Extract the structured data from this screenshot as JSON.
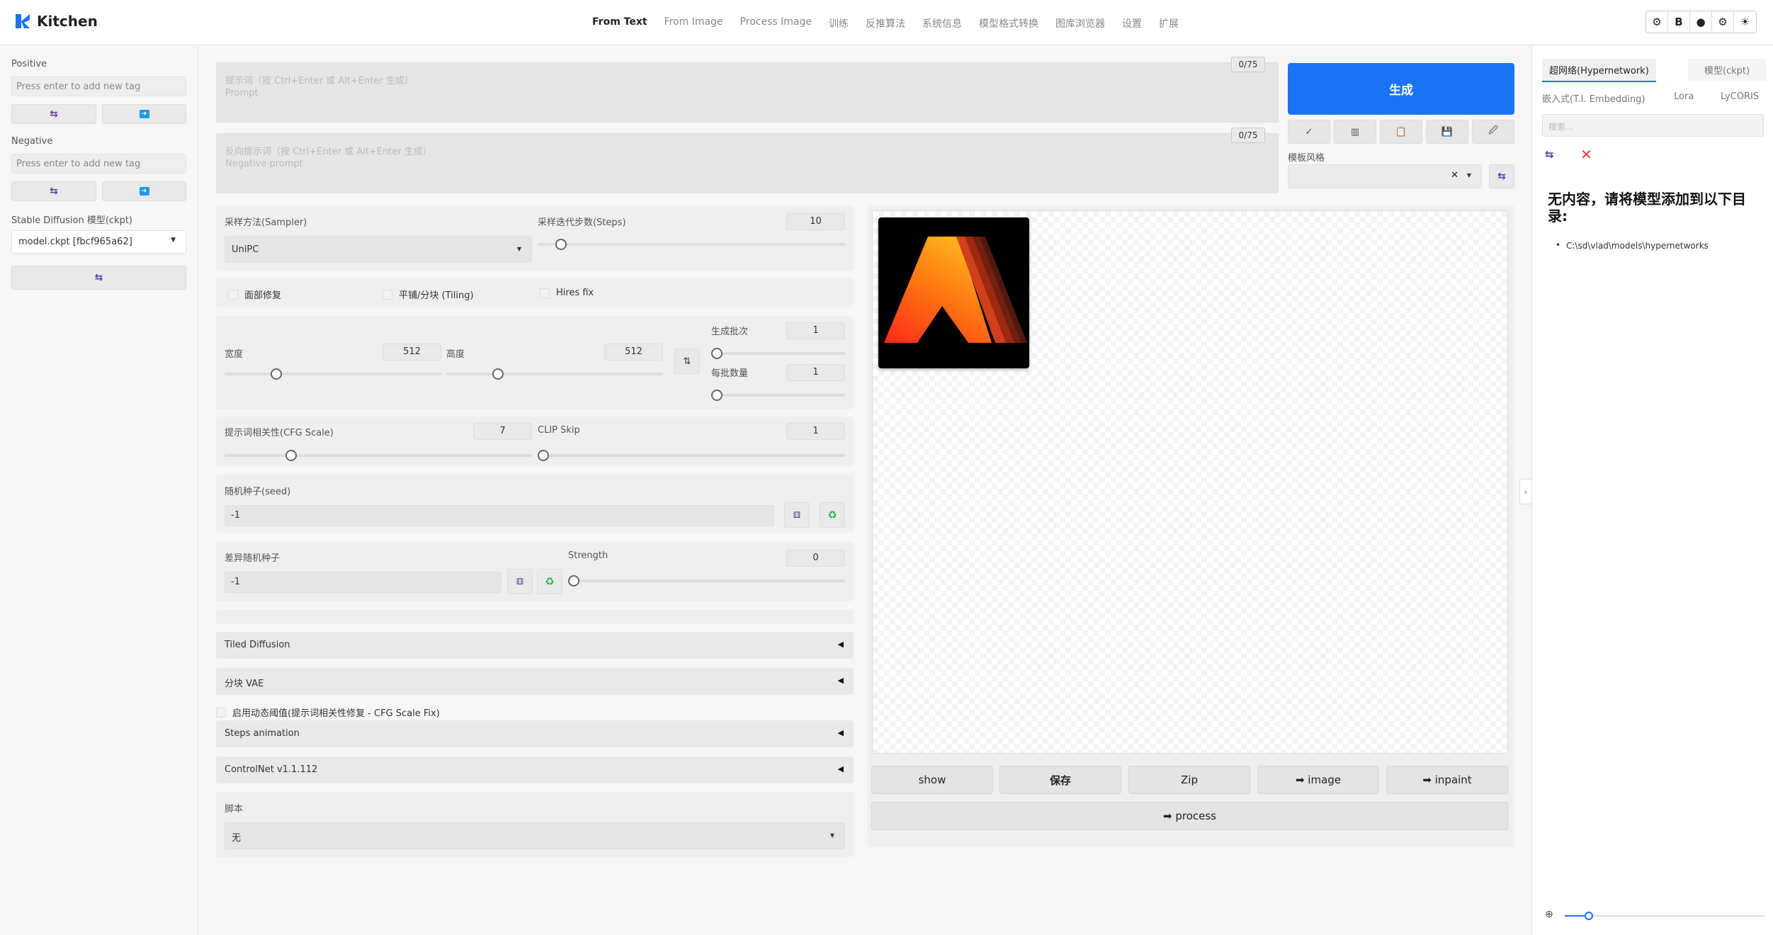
{
  "app": {
    "title": "Kitchen"
  },
  "nav": [
    "From Text",
    "From Image",
    "Process Image",
    "训练",
    "反推算法",
    "系统信息",
    "模型格式转换",
    "图库浏览器",
    "设置",
    "扩展"
  ],
  "top_icons": {
    "i1": "⚙",
    "i2": "B",
    "i3": "●",
    "i4": "⚙",
    "i5": "☀"
  },
  "left": {
    "positive_label": "Positive",
    "positive_placeholder": "Press enter to add new tag",
    "negative_label": "Negative",
    "negative_placeholder": "Press enter to add new tag",
    "model_label": "Stable Diffusion 模型(ckpt)",
    "model_value": "model.ckpt [fbcf965a62]"
  },
  "prompt": {
    "placeholder": "提示词（按 Ctrl+Enter 或 Alt+Enter 生成）",
    "sub": "Prompt",
    "counter": "0/75"
  },
  "negative": {
    "placeholder": "反向提示词（按 Ctrl+Enter 或 Alt+Enter 生成）",
    "sub": "Negative prompt",
    "counter": "0/75"
  },
  "generate_label": "生成",
  "tools": {
    "t1": "✓",
    "t2": "▥",
    "t3": "📋",
    "t4": "💾",
    "t5": "🖉"
  },
  "style": {
    "label": "模板风格",
    "clear": "✕"
  },
  "sampler": {
    "label": "采样方法(Sampler)",
    "value": "UniPC"
  },
  "steps": {
    "label": "采样迭代步数(Steps)",
    "value": 10,
    "min": 1,
    "max": 150
  },
  "checks": {
    "face": "面部修复",
    "tiling": "平铺/分块 (Tiling)",
    "hires": "Hires fix"
  },
  "width": {
    "label": "宽度",
    "value": 512,
    "min": 64,
    "max": 2048
  },
  "height": {
    "label": "高度",
    "value": 512,
    "min": 64,
    "max": 2048
  },
  "batch_count": {
    "label": "生成批次",
    "value": 1
  },
  "batch_size": {
    "label": "每批数量",
    "value": 1
  },
  "cfg": {
    "label": "提示词相关性(CFG Scale)",
    "value": 7,
    "min": 1,
    "max": 30
  },
  "clip": {
    "label": "CLIP Skip",
    "value": 1
  },
  "seed": {
    "label": "随机种子(seed)",
    "value": "-1"
  },
  "var_seed": {
    "label": "差异随机种子",
    "value": "-1"
  },
  "strength": {
    "label": "Strength",
    "value": 0
  },
  "accordions": {
    "tiled": "Tiled Diffusion",
    "vae": "分块 VAE",
    "dyn": "启用动态阈值(提示词相关性修复 - CFG Scale Fix)",
    "steps_anim": "Steps animation",
    "controlnet": "ControlNet v1.1.112"
  },
  "script": {
    "label": "脚本",
    "value": "无"
  },
  "gallery_buttons": {
    "show": "show",
    "save": "保存",
    "zip": "Zip",
    "image": "➡ image",
    "inpaint": "➡ inpaint",
    "process": "➡ process"
  },
  "right": {
    "tabs": {
      "hyper": "超网络(Hypernetwork)",
      "ckpt": "模型(ckpt)",
      "ti": "嵌入式(T.I. Embedding)",
      "lora": "Lora",
      "lycoris": "LyCORIS"
    },
    "search_placeholder": "搜索...",
    "empty_title": "无内容，请将模型添加到以下目录:",
    "path": "C:\\sd\\vlad\\models\\hypernetworks"
  },
  "colors": {
    "accent": "#1a73f5",
    "swap_icon": "#5b3fa0",
    "refresh_green": "#2bb04f",
    "close_red": "#e53935"
  }
}
